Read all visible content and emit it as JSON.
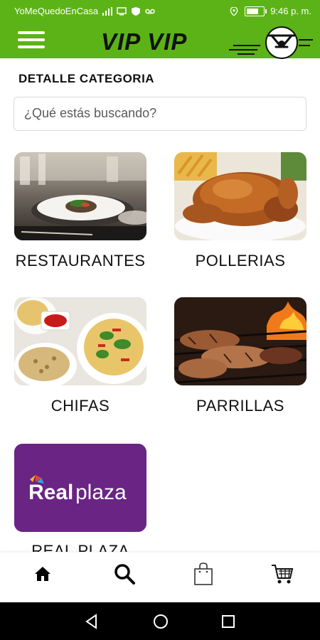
{
  "status_bar": {
    "carrier": "YoMeQuedoEnCasa",
    "time": "9:46 p. m."
  },
  "header": {
    "title": "VIP VIP",
    "accent_color": "#5cb317"
  },
  "section_title": "DETALLE CATEGORIA",
  "search": {
    "placeholder": "¿Qué estás buscando?"
  },
  "categories": [
    {
      "label": "RESTAURANTES",
      "image": "restaurant-dish-photo"
    },
    {
      "label": "POLLERIAS",
      "image": "roast-chicken-photo"
    },
    {
      "label": "CHIFAS",
      "image": "chinese-food-photo"
    },
    {
      "label": "PARRILLAS",
      "image": "grill-meat-photo"
    },
    {
      "label": "REAL PLAZA",
      "image": "realplaza-logo",
      "logo_text": "Realplaza",
      "brand_color": "#6a2484"
    }
  ],
  "bottom_nav": [
    {
      "name": "home",
      "icon": "home-icon"
    },
    {
      "name": "search",
      "icon": "search-icon"
    },
    {
      "name": "bag",
      "icon": "shopping-bag-icon"
    },
    {
      "name": "cart",
      "icon": "cart-icon"
    }
  ]
}
